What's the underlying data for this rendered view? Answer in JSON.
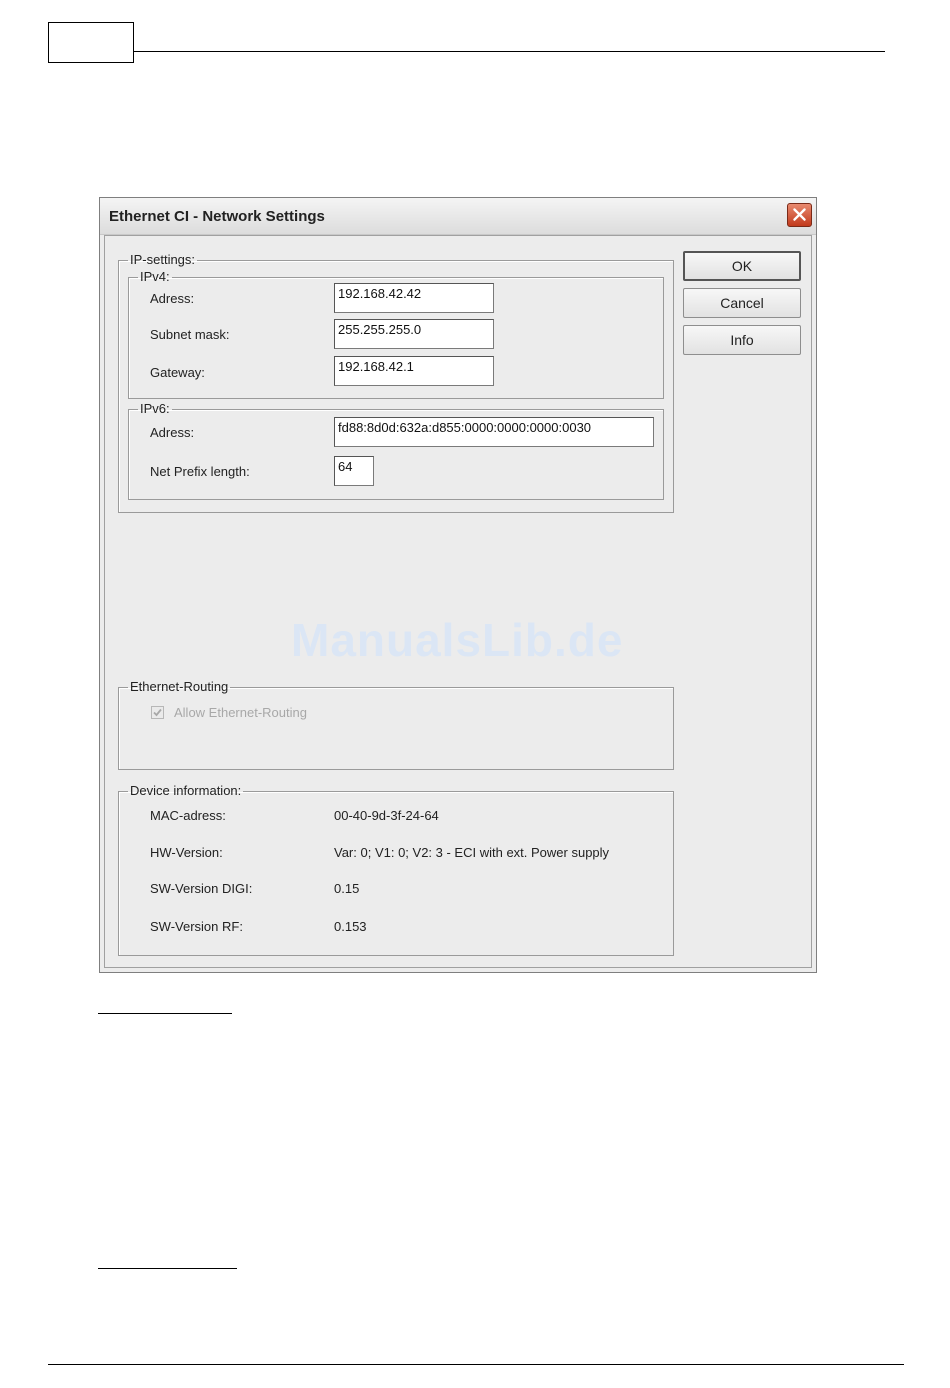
{
  "dialog": {
    "title": "Ethernet CI - Network Settings",
    "buttons": {
      "ok": "OK",
      "cancel": "Cancel",
      "info": "Info"
    }
  },
  "ip_settings": {
    "legend": "IP-settings:",
    "ipv4": {
      "legend": "IPv4:",
      "address_label": "Adress:",
      "address_value": "192.168.42.42",
      "subnet_label": "Subnet mask:",
      "subnet_value": "255.255.255.0",
      "gateway_label": "Gateway:",
      "gateway_value": "192.168.42.1"
    },
    "ipv6": {
      "legend": "IPv6:",
      "address_label": "Adress:",
      "address_value": "fd88:8d0d:632a:d855:0000:0000:0000:0030",
      "prefix_label": "Net Prefix length:",
      "prefix_value": "64"
    }
  },
  "routing": {
    "legend": "Ethernet-Routing",
    "checkbox_label": "Allow Ethernet-Routing",
    "checked": true,
    "disabled": true
  },
  "device_info": {
    "legend": "Device information:",
    "rows": [
      {
        "label": "MAC-adress:",
        "value": "00-40-9d-3f-24-64"
      },
      {
        "label": "HW-Version:",
        "value": "Var: 0;  V1: 0;  V2: 3 - ECI with ext. Power supply"
      },
      {
        "label": "SW-Version DIGI:",
        "value": "0.15"
      },
      {
        "label": "SW-Version RF:",
        "value": "0.153"
      }
    ]
  },
  "watermark": "ManualsLib.de",
  "colors": {
    "close_button": "#c23a1c",
    "watermark": "#dbe6f5"
  }
}
